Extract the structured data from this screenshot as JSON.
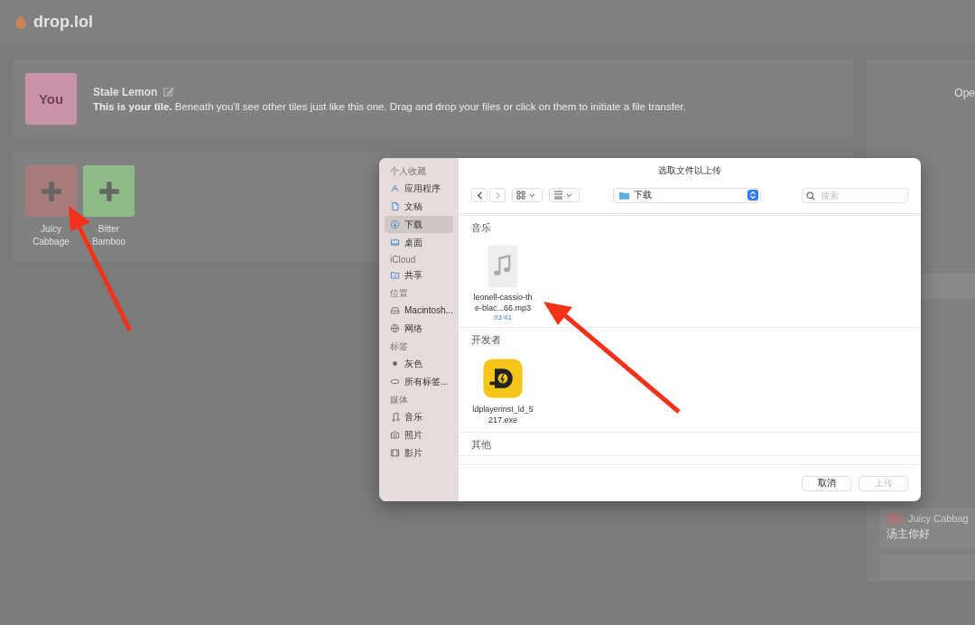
{
  "app": {
    "name": "drop.lol"
  },
  "self_tile": {
    "avatar": "You",
    "name": "Stale Lemon",
    "description": "**This is your tile.** Beneath you'll see other tiles just like this one. Drag and drop your files or click on them to initiate a file transfer."
  },
  "peers": [
    {
      "name": "Juicy Cabbage",
      "color": "#a87a7c"
    },
    {
      "name": "Bitter Bamboo",
      "color": "#8fbb86"
    }
  ],
  "side_panel": {
    "heading": "Ope",
    "messages": [
      {
        "sender": "Juicy Cabbag",
        "color": "#a87a7c",
        "text": "汤主你好"
      }
    ]
  },
  "dialog": {
    "title": "选取文件以上传",
    "sidebar": [
      {
        "heading": "个人收藏",
        "items": [
          {
            "label": "应用程序",
            "kind": "apps",
            "selected": false
          },
          {
            "label": "文稿",
            "kind": "doc",
            "selected": false
          },
          {
            "label": "下载",
            "kind": "download",
            "selected": true
          },
          {
            "label": "桌面",
            "kind": "desktop",
            "selected": false
          }
        ]
      },
      {
        "heading": "iCloud",
        "items": [
          {
            "label": "共享",
            "kind": "shared",
            "selected": false
          }
        ]
      },
      {
        "heading": "位置",
        "items": [
          {
            "label": "Macintosh...",
            "kind": "disk",
            "selected": false
          },
          {
            "label": "网络",
            "kind": "network",
            "selected": false
          }
        ]
      },
      {
        "heading": "标签",
        "items": [
          {
            "label": "灰色",
            "kind": "dot",
            "selected": false
          },
          {
            "label": "所有标签...",
            "kind": "tags",
            "selected": false
          }
        ]
      },
      {
        "heading": "媒体",
        "items": [
          {
            "label": "音乐",
            "kind": "music",
            "selected": false
          },
          {
            "label": "照片",
            "kind": "photo",
            "selected": false
          },
          {
            "label": "影片",
            "kind": "movie",
            "selected": false
          }
        ]
      }
    ],
    "location": "下载",
    "search_placeholder": "搜索",
    "groups": [
      {
        "heading": "音乐",
        "files": [
          {
            "name": "leonell-cassio-the-blac...66.mp3",
            "kind": "audio",
            "meta": "03:41"
          }
        ]
      },
      {
        "heading": "开发者",
        "files": [
          {
            "name": "ldplayerinst_ld_5217.exe",
            "kind": "app"
          }
        ]
      },
      {
        "heading": "其他"
      }
    ],
    "buttons": [
      {
        "label": "取消",
        "disabled": false
      },
      {
        "label": "上传",
        "disabled": true
      }
    ]
  }
}
